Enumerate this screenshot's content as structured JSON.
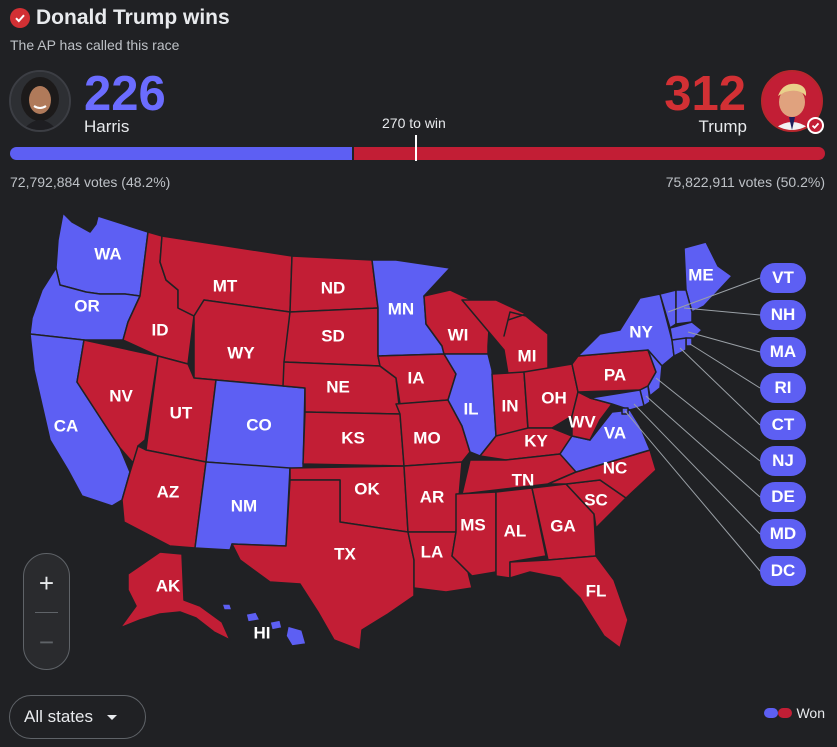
{
  "header": {
    "headline": "Donald Trump wins",
    "subline": "The AP has called this race"
  },
  "candidates": {
    "harris": {
      "name": "Harris",
      "electoral_votes": "226",
      "votes": "72,792,884 votes (48.2%)",
      "color": "#5d5ff3"
    },
    "trump": {
      "name": "Trump",
      "electoral_votes": "312",
      "votes": "75,822,911 votes (50.2%)",
      "color": "#c21e35"
    }
  },
  "bar": {
    "to_win_label": "270 to win",
    "total_electoral_votes": 538,
    "threshold": 270
  },
  "map": {
    "states": {
      "WA": "D",
      "OR": "D",
      "CA": "D",
      "NV": "R",
      "ID": "R",
      "MT": "R",
      "WY": "R",
      "UT": "R",
      "AZ": "R",
      "CO": "D",
      "NM": "D",
      "ND": "R",
      "SD": "R",
      "NE": "R",
      "KS": "R",
      "OK": "R",
      "TX": "R",
      "MN": "D",
      "IA": "R",
      "MO": "R",
      "AR": "R",
      "LA": "R",
      "WI": "R",
      "IL": "D",
      "MI": "R",
      "IN": "R",
      "OH": "R",
      "KY": "R",
      "TN": "R",
      "MS": "R",
      "AL": "R",
      "GA": "R",
      "FL": "R",
      "SC": "R",
      "NC": "R",
      "VA": "D",
      "WV": "R",
      "PA": "R",
      "NY": "D",
      "ME": "D",
      "VT": "D",
      "NH": "D",
      "MA": "D",
      "RI": "D",
      "CT": "D",
      "NJ": "D",
      "DE": "D",
      "MD": "D",
      "DC": "D",
      "AK": "R",
      "HI": "D"
    },
    "small_state_labels": [
      "VT",
      "NH",
      "MA",
      "RI",
      "CT",
      "NJ",
      "DE",
      "MD",
      "DC"
    ]
  },
  "controls": {
    "zoom_in": "+",
    "zoom_out": "−",
    "filter_label": "All states"
  },
  "legend": {
    "label": "Won"
  }
}
